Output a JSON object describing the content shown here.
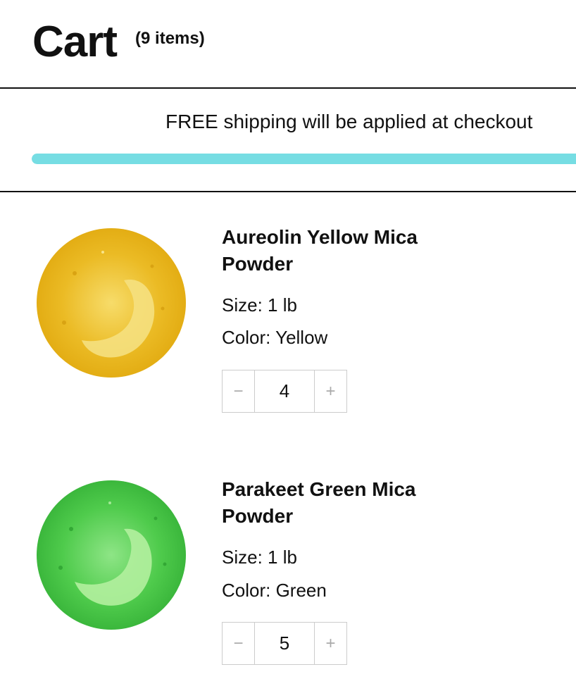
{
  "cart": {
    "title": "Cart",
    "count": "(9 items)"
  },
  "shipping": {
    "message": "FREE shipping will be applied at checkout",
    "progress_percent": 100,
    "color": "#76dde3"
  },
  "items": [
    {
      "name": "Aureolin Yellow Mica Powder",
      "size": "Size: 1 lb",
      "color": "Color: Yellow",
      "quantity": "4",
      "swatch": "#e8b922"
    },
    {
      "name": "Parakeet Green Mica Powder",
      "size": "Size: 1 lb",
      "color": "Color: Green",
      "quantity": "5",
      "swatch": "#46c64a"
    }
  ],
  "stepper": {
    "decrement": "−",
    "increment": "+"
  }
}
